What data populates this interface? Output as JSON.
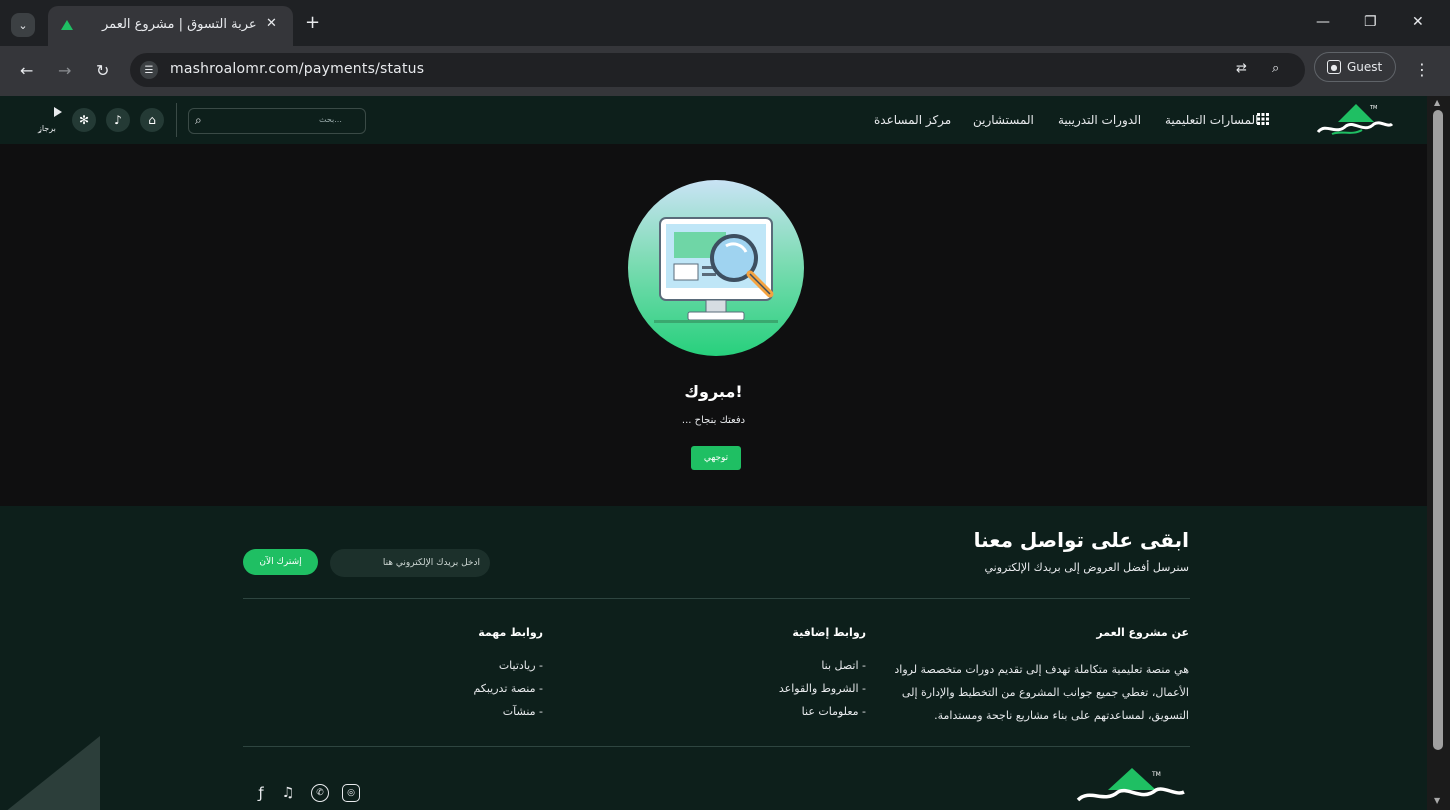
{
  "browser": {
    "tab_title": "عربة التسوق | مشروع العمر",
    "url": "mashroalomr.com/payments/status",
    "profile_label": "Guest"
  },
  "header": {
    "nav": [
      "المسارات التعليمية",
      "الدورات التدريبية",
      "المستشارين",
      "مركز المساعدة"
    ],
    "search_placeholder": "بحث...",
    "user_name": "ٍبرجاز"
  },
  "main": {
    "heading": "مبروك!",
    "message": "دفعتك بنجاح ...",
    "button_label": "توجهي"
  },
  "footer": {
    "title": "ابقى على تواصل معنا",
    "subtitle": "سنرسل أفضل العروض إلى بريدك الإلكتروني",
    "email_placeholder": "أدخل بريدك الإلكتروني هنا",
    "subscribe_label": "إشترك الآن",
    "about_title": "عن مشروع العمر",
    "about_text": "هي منصة تعليمية متكاملة تهدف إلى تقديم دورات متخصصة لرواد الأعمال، تغطي جميع جوانب المشروع من التخطيط والإدارة إلى التسويق، لمساعدتهم على بناء مشاريع ناجحة ومستدامة.",
    "extra_title": "روابط إضافية",
    "extra_links": [
      "- اتصل بنا",
      "- الشروط والقواعد",
      "- معلومات عنا"
    ],
    "important_title": "روابط مهمة",
    "important_links": [
      "- ريادتيات",
      "- منصة تدريبكم",
      "- منشآت"
    ]
  },
  "colors": {
    "accent": "#1fbf63",
    "header_bg": "#0d1f1b",
    "main_bg": "#0f0f10"
  }
}
